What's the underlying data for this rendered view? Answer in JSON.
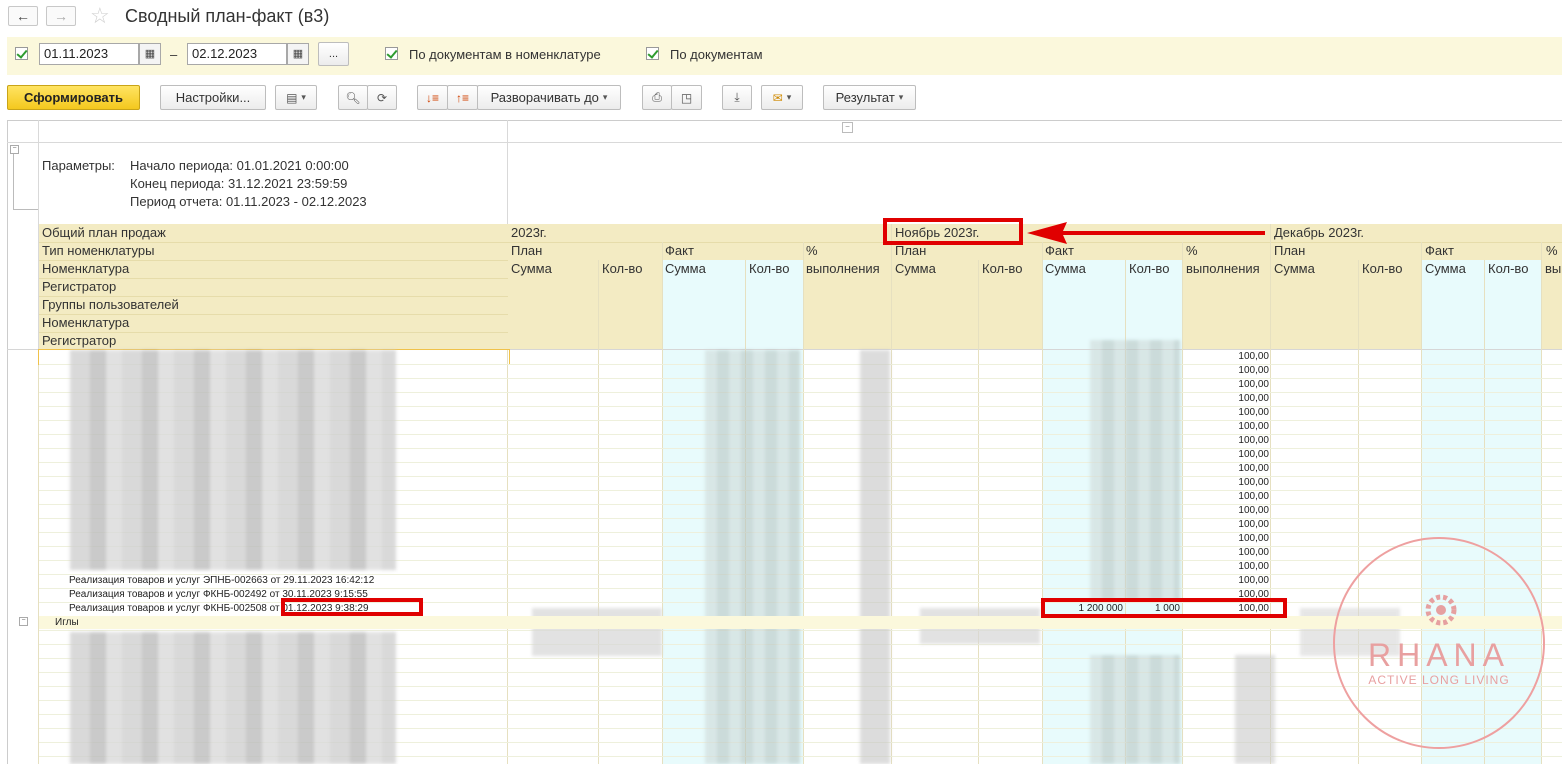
{
  "window": {
    "title": "Сводный план-факт (в3)"
  },
  "filters": {
    "date_from": "01.11.2023",
    "date_to": "02.12.2023",
    "dash": "–",
    "more_label": "...",
    "by_docs_in_nomenclature": "По документам в номенклатуре",
    "by_docs": "По документам"
  },
  "toolbar": {
    "generate": "Сформировать",
    "settings": "Настройки...",
    "expand_to": "Разворачивать до",
    "result": "Результат"
  },
  "params": {
    "label": "Параметры:",
    "line1": "Начало периода: 01.01.2021 0:00:00",
    "line2": "Конец периода: 31.12.2021 23:59:59",
    "line3": "Период отчета: 01.11.2023 - 02.12.2023"
  },
  "row_headers": [
    "Общий план продаж",
    "Тип номенклатуры",
    "Номенклатура",
    "Регистратор",
    "Группы пользователей",
    "Номенклатура",
    "Регистратор"
  ],
  "periods": {
    "year": "2023г.",
    "nov": "Ноябрь 2023г.",
    "dec": "Декабрь 2023г."
  },
  "col": {
    "plan": "План",
    "fact": "Факт",
    "pct": "%",
    "pct_full": "выполнения",
    "pct_cut": "вы",
    "sum": "Сумма",
    "qty": "Кол-во"
  },
  "pct_values": [
    "100,00",
    "100,00",
    "100,00",
    "100,00",
    "100,00",
    "100,00",
    "100,00",
    "100,00",
    "100,00",
    "100,00",
    "100,00",
    "100,00",
    "100,00",
    "100,00",
    "100,00",
    "100,00",
    "100,00",
    "100,00"
  ],
  "doc_rows": [
    "Реализация товаров и услуг ЭПНБ-002663 от 29.11.2023 16:42:12",
    "Реализация товаров и услуг ФКНБ-002492 от 30.11.2023 9:15:55",
    "Реализация товаров и услуг ФКНБ-002508 от 01.12.2023 9:38:29"
  ],
  "highlight_row": {
    "sum": "1 200 000",
    "qty": "1 000",
    "pct": "100,00"
  },
  "group_row": {
    "label": "Иглы"
  },
  "watermark": {
    "brand": "RHANA",
    "tagline": "ACTIVE LONG LIVING"
  },
  "colors": {
    "accent_red": "#e00000",
    "header_bg": "#f3ebc3",
    "fact_bg": "#e8fbfc",
    "filter_bg": "#fbf8dc",
    "generate_btn": "#f4c81e"
  }
}
